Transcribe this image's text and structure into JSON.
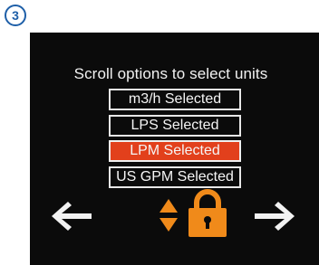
{
  "step_badge": "3",
  "screen": {
    "title": "Scroll options to select units",
    "options": [
      {
        "label": "m3/h Selected",
        "selected": false
      },
      {
        "label": "LPS Selected",
        "selected": false
      },
      {
        "label": "LPM Selected",
        "selected": true
      },
      {
        "label": "US GPM Selected",
        "selected": false
      }
    ],
    "nav": {
      "left_icon": "left-arrow-icon",
      "updown_icon": "up-down-arrows-icon",
      "lock_icon": "lock-icon",
      "right_icon": "right-arrow-icon"
    }
  },
  "colors": {
    "badge": "#1e5fa8",
    "screen_bg": "#0b0b0b",
    "selected_bg": "#e2401c",
    "accent_orange": "#f08a1a",
    "arrow": "#f2f2f2"
  }
}
